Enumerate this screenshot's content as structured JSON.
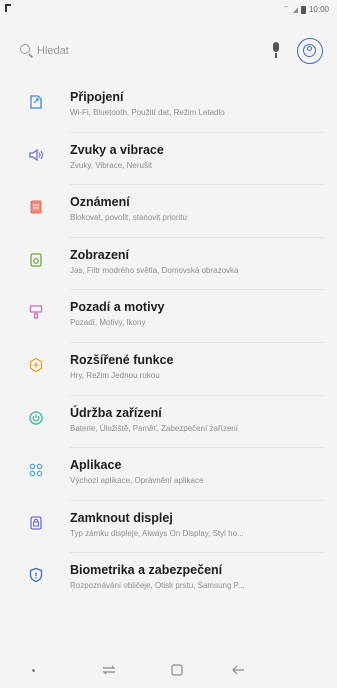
{
  "status_bar": {
    "time": "10:00"
  },
  "search": {
    "placeholder": "Hledat"
  },
  "items": [
    {
      "title": "Připojení",
      "subtitle": "Wi-Fi, Bluetooth, Použití dat, Režim Letadlo",
      "icon": "link-icon",
      "color": "#3f8ad6"
    },
    {
      "title": "Zvuky a vibrace",
      "subtitle": "Zvuky, Vibrace, Nerušit",
      "icon": "speaker-icon",
      "color": "#6f6fd6"
    },
    {
      "title": "Oznámení",
      "subtitle": "Blokovat, povolit, stanovit prioritu",
      "icon": "notification-icon",
      "color": "#e46a5e"
    },
    {
      "title": "Zobrazení",
      "subtitle": "Jas, Filtr modrého světla, Domovská obrazovka",
      "icon": "display-icon",
      "color": "#6aa53b"
    },
    {
      "title": "Pozadí a motivy",
      "subtitle": "Pozadí, Motivy, Ikony",
      "icon": "brush-icon",
      "color": "#c96cc0"
    },
    {
      "title": "Rozšířené funkce",
      "subtitle": "Hry, Režim Jednou rukou",
      "icon": "gear-plus-icon",
      "color": "#e3a72f"
    },
    {
      "title": "Údržba zařízení",
      "subtitle": "Baterie, Úložiště, Paměť, Zabezpečení zařízení",
      "icon": "maintenance-icon",
      "color": "#3db3a3"
    },
    {
      "title": "Aplikace",
      "subtitle": "Výchozí aplikace, Oprávnění aplikace",
      "icon": "apps-icon",
      "color": "#4aa3d6"
    },
    {
      "title": "Zamknout displej",
      "subtitle": "Typ zámku displeje, Always On Display, Styl ho...",
      "icon": "lock-screen-icon",
      "color": "#6f6fd6"
    },
    {
      "title": "Biometrika a zabezpečení",
      "subtitle": "Rozpoznávání obličeje, Otisk prstu, Samsung P...",
      "icon": "shield-icon",
      "color": "#3f6fb5"
    }
  ]
}
